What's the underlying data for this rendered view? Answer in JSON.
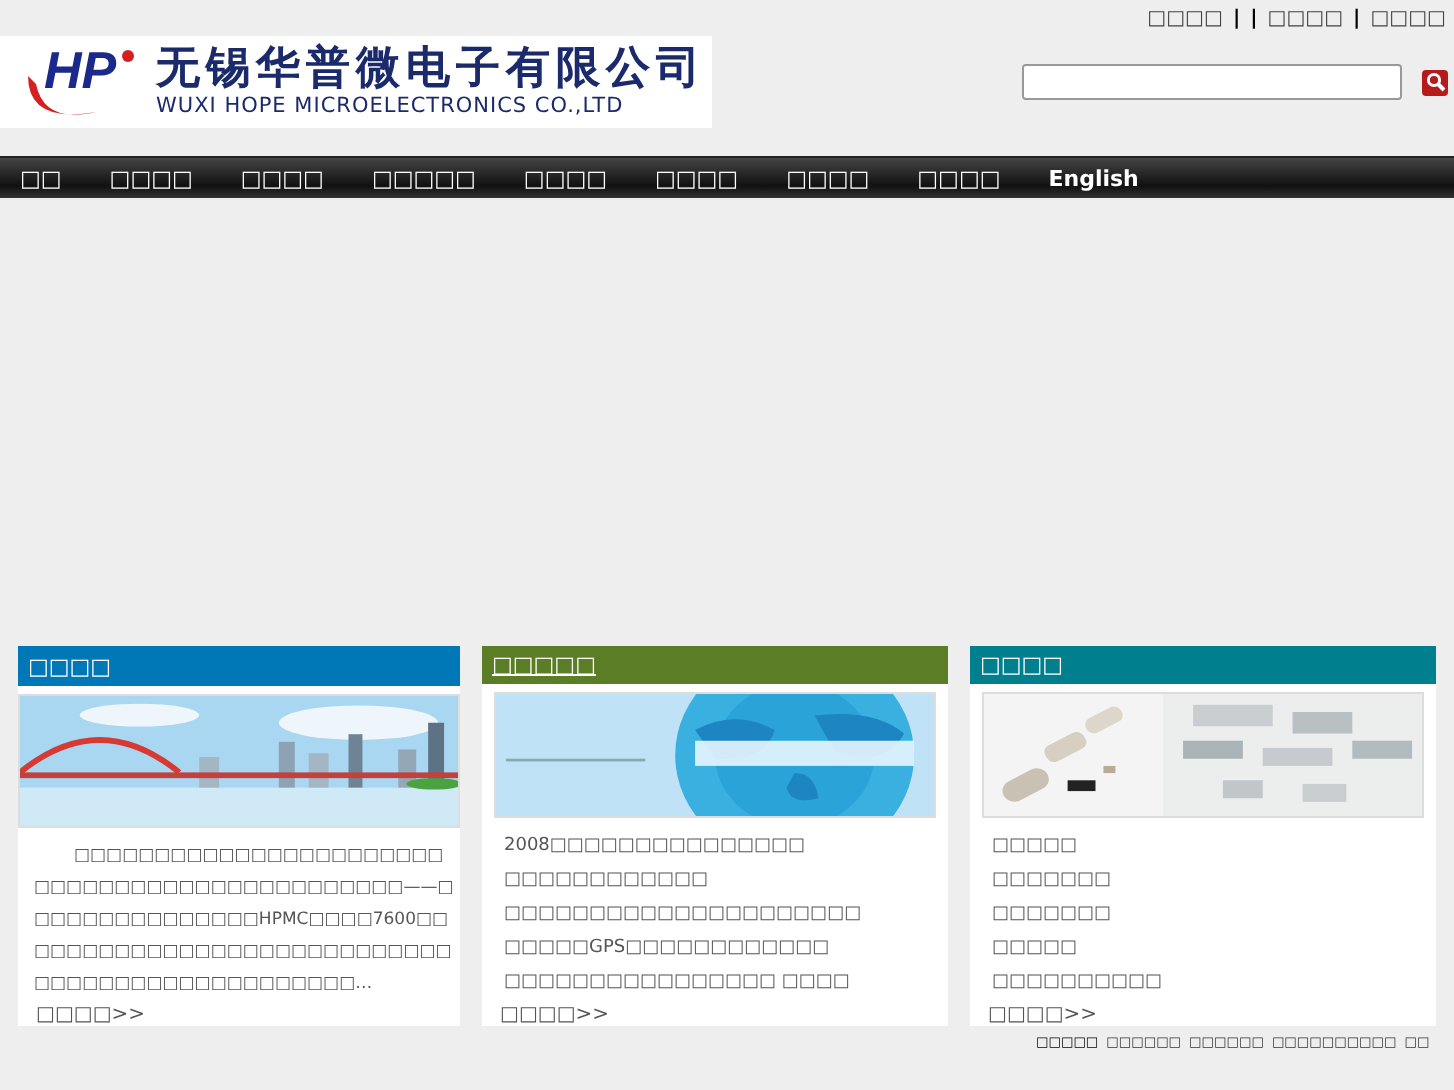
{
  "top_links": [
    {
      "kind": "link",
      "text": "□□□□"
    },
    {
      "kind": "separator",
      "text": "|"
    },
    {
      "kind": "separator",
      "text": "|"
    },
    {
      "kind": "link",
      "text": "□□□□"
    },
    {
      "kind": "separator",
      "text": "|"
    },
    {
      "kind": "link",
      "text": "□□□□"
    }
  ],
  "logo": {
    "chinese": "无锡华普微电子有限公司",
    "english": "WUXI HOPE MICROELECTRONICS CO.,LTD",
    "mark": "HP"
  },
  "nav": [
    {
      "label": "□□",
      "selected": false
    },
    {
      "label": "□□□□",
      "selected": false
    },
    {
      "label": "□□□□",
      "selected": false
    },
    {
      "label": "□□□□□",
      "selected": false
    },
    {
      "label": "□□□□",
      "selected": false
    },
    {
      "label": "□□□□",
      "selected": false
    },
    {
      "label": "□□□□",
      "selected": false
    },
    {
      "label": "□□□□",
      "selected": false
    },
    {
      "label": "English",
      "selected": false
    }
  ],
  "panels": [
    {
      "kind": "text",
      "title": "□□□□",
      "color": "#0077b6",
      "text": "□□□□□□□□□□□□□□□□□□□□□□□□□□□□□□□□□□□□□□□□□□□□□□——□□□□□□□□□□□□□□□HPMC□□□□7600□□□□□□□□□□□□□□□□□□□□□□□□□□□□□□□□□□□□□□□□□□□□□□□□…",
      "more": "□□□□>>"
    },
    {
      "kind": "list",
      "title": "□□□□□",
      "color": "#5a7d25",
      "items": [
        "2008□□□□□□□□□□□□□□□",
        "□□□□□□□□□□□□",
        "□□□□□□□□□□□□□□□□□□□□□",
        "□□□□□GPS□□□□□□□□□□□□",
        "□□□□□□□□□□□□□□□□ □□□□"
      ],
      "more": "□□□□>>"
    },
    {
      "kind": "list",
      "title": "□□□□",
      "color": "#00808f",
      "items": [
        "□□□□□",
        "□□□□□□□",
        "□□□□□□□",
        "□□□□□",
        "□□□□□□□□□□"
      ],
      "more": "□□□□>>"
    }
  ],
  "footer_links": [
    "□□□□□",
    "□□□□□□",
    "□□□□□□",
    "□□□□□□□□□□",
    "□□"
  ]
}
